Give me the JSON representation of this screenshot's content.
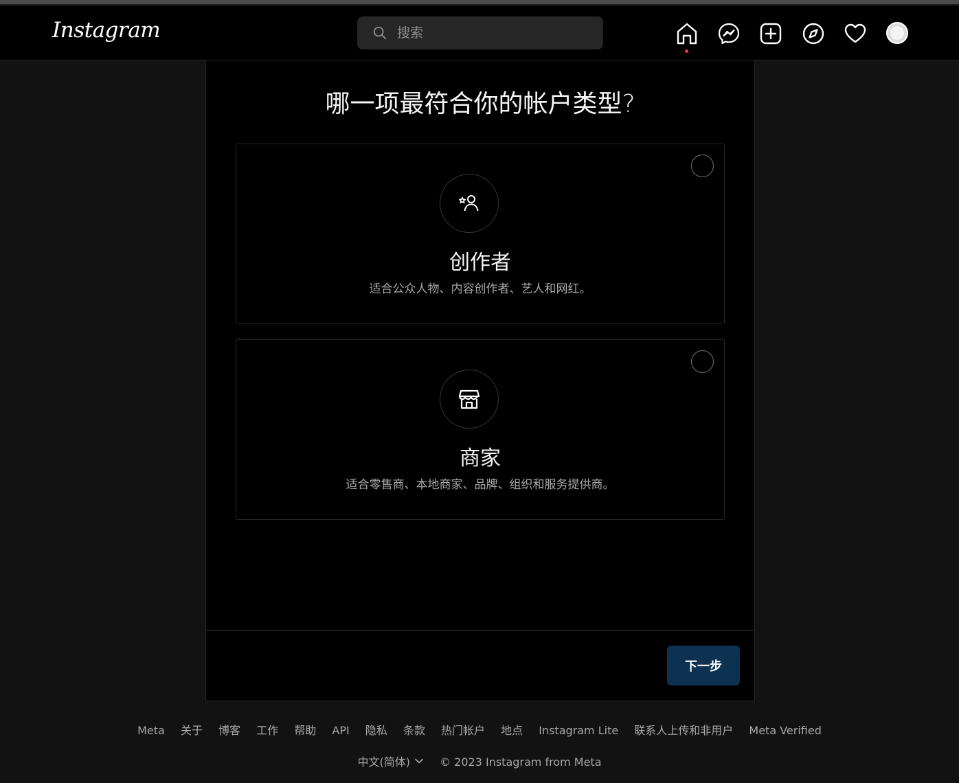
{
  "navbar": {
    "logo": "Instagram",
    "search_placeholder": "搜索",
    "icons": [
      "home-icon",
      "messenger-icon",
      "create-icon",
      "explore-icon",
      "activity-heart-icon",
      "profile-avatar"
    ]
  },
  "panel": {
    "title": "哪一项最符合你的帐户类型?",
    "options": [
      {
        "title": "创作者",
        "description": "适合公众人物、内容创作者、艺人和网红。",
        "icon": "creator-star-person-icon"
      },
      {
        "title": "商家",
        "description": "适合零售商、本地商家、品牌、组织和服务提供商。",
        "icon": "storefront-icon"
      }
    ],
    "next_label": "下一步"
  },
  "footer": {
    "links": [
      "Meta",
      "关于",
      "博客",
      "工作",
      "帮助",
      "API",
      "隐私",
      "条款",
      "热门帐户",
      "地点",
      "Instagram Lite",
      "联系人上传和非用户",
      "Meta Verified"
    ],
    "language": "中文(简体)",
    "copyright": "© 2023 Instagram from Meta"
  },
  "colors": {
    "background": "#121212",
    "panel": "#000000",
    "next_button": "#0c3151",
    "notification_dot": "#ff3040"
  }
}
